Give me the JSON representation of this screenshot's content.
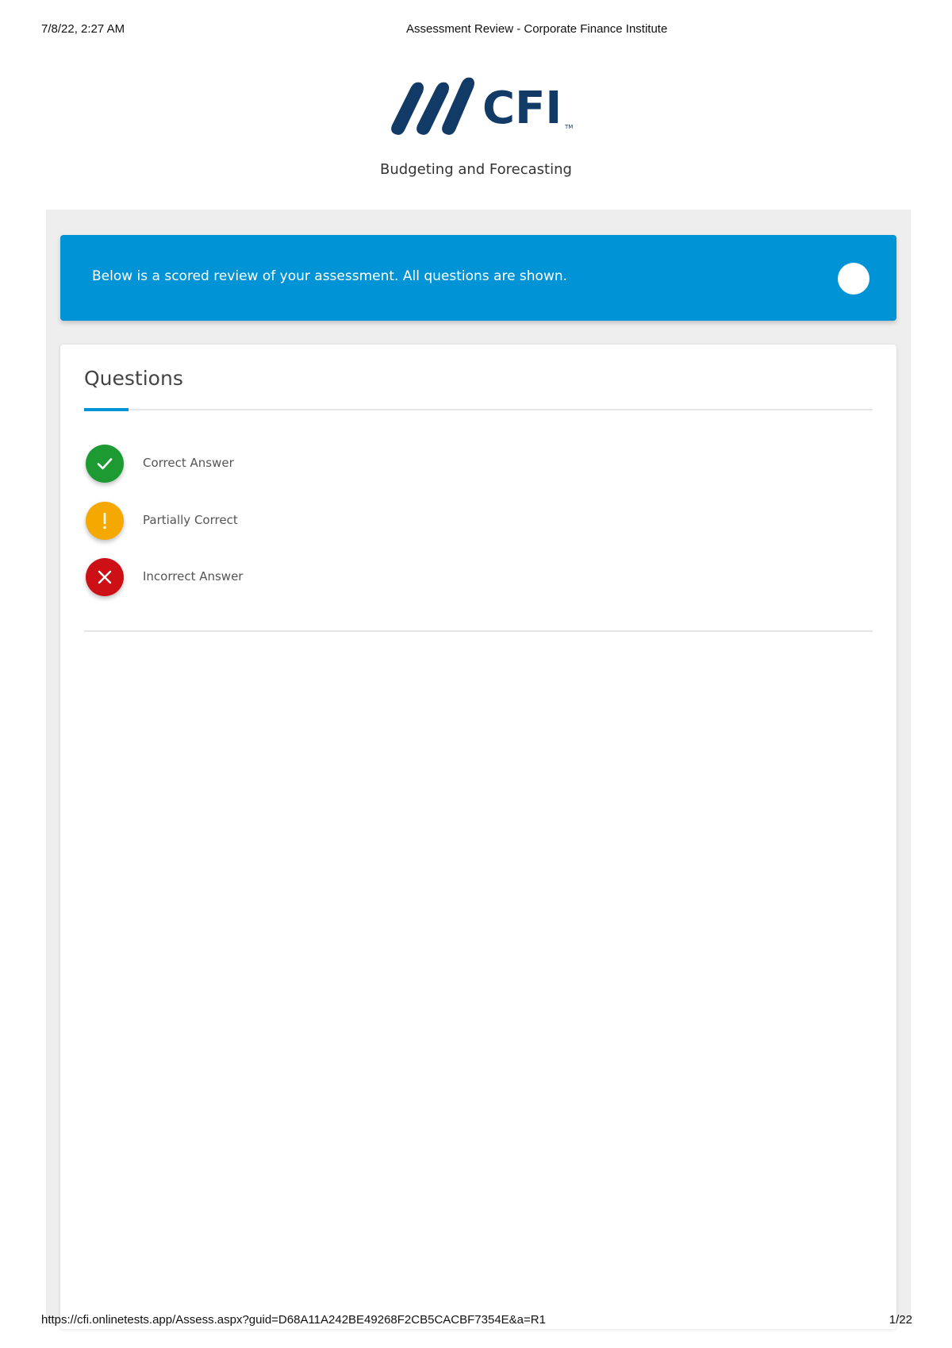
{
  "print_header": {
    "datetime": "7/8/22, 2:27 AM",
    "page_title": "Assessment Review - Corporate Finance Institute"
  },
  "logo": {
    "text": "CFI",
    "trademark": "TM",
    "color": "#123a66"
  },
  "course_title": "Budgeting and Forecasting",
  "banner": {
    "message": "Below is a scored review of your assessment. All questions are shown.",
    "color": "#0093d5"
  },
  "questions_card": {
    "title": "Questions",
    "legend": [
      {
        "label": "Correct Answer",
        "icon": "check-icon",
        "color": "#1e9a33"
      },
      {
        "label": "Partially Correct",
        "icon": "exclamation-icon",
        "color": "#f5a800"
      },
      {
        "label": "Incorrect Answer",
        "icon": "x-icon",
        "color": "#cc1016"
      }
    ]
  },
  "print_footer": {
    "url": "https://cfi.onlinetests.app/Assess.aspx?guid=D68A11A242BE49268F2CB5CACBF7354E&a=R1",
    "page": "1/22"
  }
}
